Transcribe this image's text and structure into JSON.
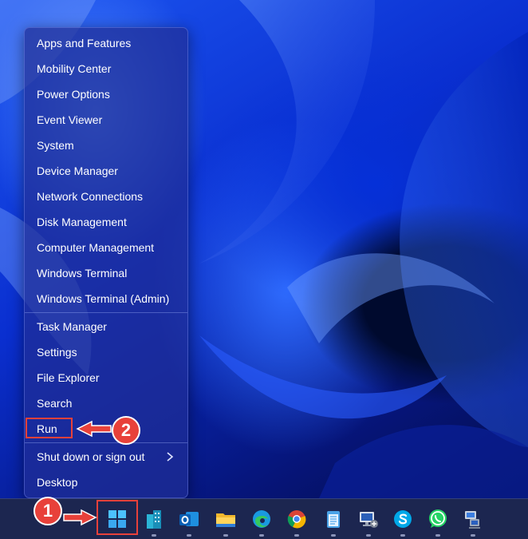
{
  "context_menu": {
    "items": [
      {
        "label": "Apps and Features"
      },
      {
        "label": "Mobility Center"
      },
      {
        "label": "Power Options"
      },
      {
        "label": "Event Viewer"
      },
      {
        "label": "System"
      },
      {
        "label": "Device Manager"
      },
      {
        "label": "Network Connections"
      },
      {
        "label": "Disk Management"
      },
      {
        "label": "Computer Management"
      },
      {
        "label": "Windows Terminal"
      },
      {
        "label": "Windows Terminal (Admin)"
      },
      {
        "label": "Task Manager"
      },
      {
        "label": "Settings"
      },
      {
        "label": "File Explorer"
      },
      {
        "label": "Search"
      },
      {
        "label": "Run"
      },
      {
        "label": "Shut down or sign out"
      },
      {
        "label": "Desktop"
      }
    ]
  },
  "annotations": {
    "step1": "1",
    "step2": "2",
    "highlight_color": "#e8413a"
  },
  "taskbar": {
    "icons": [
      "windows-start-icon",
      "office-buildings-icon",
      "outlook-icon",
      "file-explorer-icon",
      "edge-icon",
      "chrome-icon",
      "notepad-icon",
      "remote-desktop-icon",
      "skype-icon",
      "whatsapp-icon",
      "network-computer-icon"
    ]
  }
}
